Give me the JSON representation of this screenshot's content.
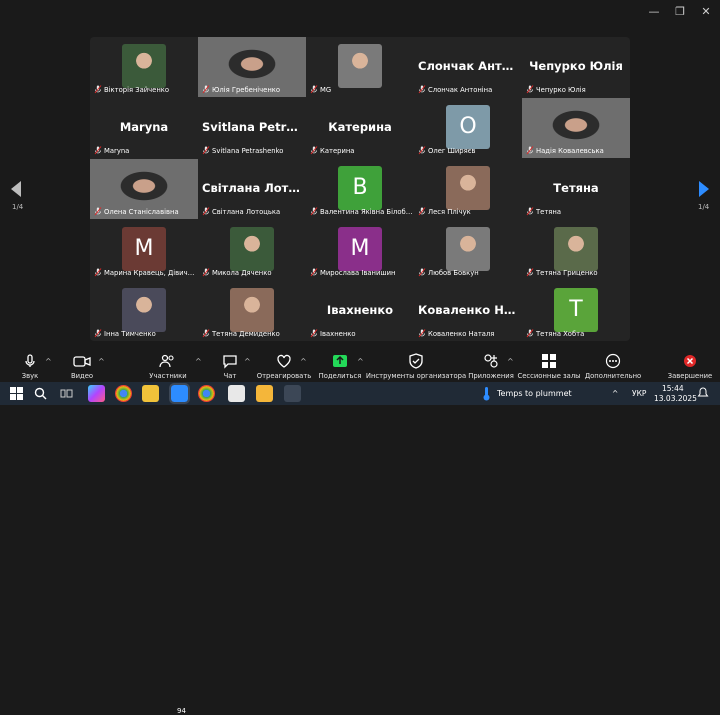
{
  "window": {
    "minimize": "—",
    "restore": "❐",
    "close": "✕"
  },
  "gallery": {
    "page_left": "1/4",
    "page_right": "1/4",
    "tiles": [
      {
        "label": "Вікторія Зайченко",
        "type": "photo"
      },
      {
        "label": "Юлія Гребеніченко",
        "type": "video",
        "active": true
      },
      {
        "label": "MG",
        "type": "photo"
      },
      {
        "label": "Слончак Антоніна",
        "type": "name",
        "big": "Слончак Антон…"
      },
      {
        "label": "Чепурко Юлія",
        "type": "name",
        "big": "Чепурко Юлія"
      },
      {
        "label": "Maryna",
        "type": "name",
        "big": "Maryna"
      },
      {
        "label": "Svitlana Petrashenko",
        "type": "name",
        "big": "Svitlana Petrash…"
      },
      {
        "label": "Катерина",
        "type": "name",
        "big": "Катерина"
      },
      {
        "label": "Олег Ширяєв",
        "type": "letter",
        "letter": "O",
        "color": "#7e9aa8"
      },
      {
        "label": "Надія Ковалевська",
        "type": "video"
      },
      {
        "label": "Олена Станіславівна",
        "type": "video"
      },
      {
        "label": "Світлана Лотоцька",
        "type": "name",
        "big": "Світлана Лотоц…"
      },
      {
        "label": "Валентина Яківна Білобриц…",
        "type": "letter",
        "letter": "В",
        "color": "#3fa13a"
      },
      {
        "label": "Леся Плічук",
        "type": "photo"
      },
      {
        "label": "Тетяна",
        "type": "name",
        "big": "Тетяна"
      },
      {
        "label": "Марина Кравець, Дівичків…",
        "type": "letter",
        "letter": "М",
        "color": "#6b3a34"
      },
      {
        "label": "Микола Дяченко",
        "type": "photo"
      },
      {
        "label": "Мирослава Іванишин",
        "type": "letter",
        "letter": "М",
        "color": "#8a2f8a"
      },
      {
        "label": "Любов Бовкун",
        "type": "photo"
      },
      {
        "label": "Тетяна Гриценко",
        "type": "photo"
      },
      {
        "label": "Інна Тимченко",
        "type": "photo"
      },
      {
        "label": "Тетяна Демиденко",
        "type": "photo"
      },
      {
        "label": "Івахненко",
        "type": "name",
        "big": "Івахненко"
      },
      {
        "label": "Коваленко Наталя",
        "type": "name",
        "big": "Коваленко Нат…"
      },
      {
        "label": "Тетяна Хобта",
        "type": "letter",
        "letter": "T",
        "color": "#5aa43a"
      }
    ]
  },
  "toolbar": {
    "audio": "Звук",
    "video": "Видео",
    "participants": "Участники",
    "participants_count": "94",
    "chat": "Чат",
    "react": "Отреагировать",
    "share": "Поделиться",
    "host_tools": "Инструменты организатора",
    "apps": "Приложения",
    "breakout": "Сессионные залы",
    "more": "Дополнительно",
    "end": "Завершение"
  },
  "taskbar": {
    "weather": "Temps to plummet",
    "lang": "УКР",
    "time": "15:44",
    "date": "13.03.2025"
  }
}
